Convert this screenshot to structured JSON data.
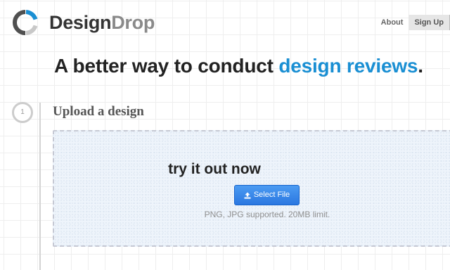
{
  "brand": {
    "name_strong": "Design",
    "name_light": "Drop",
    "icon": "designdrop-logo-icon",
    "colors": {
      "mark_dark": "#505050",
      "mark_blue": "#1a8fd3",
      "mark_gray": "#c8c8c8"
    }
  },
  "nav": {
    "about": "About",
    "signup": "Sign Up"
  },
  "headline": {
    "text": "A better way to conduct ",
    "accent": "design reviews",
    "end": ".",
    "accent_color": "#1a8fd3"
  },
  "step": {
    "number": "1",
    "title": "Upload a design"
  },
  "upload": {
    "title": "try it out now",
    "button_label": "Select File",
    "button_icon": "upload-icon",
    "note": "PNG, JPG supported. 20MB limit."
  }
}
